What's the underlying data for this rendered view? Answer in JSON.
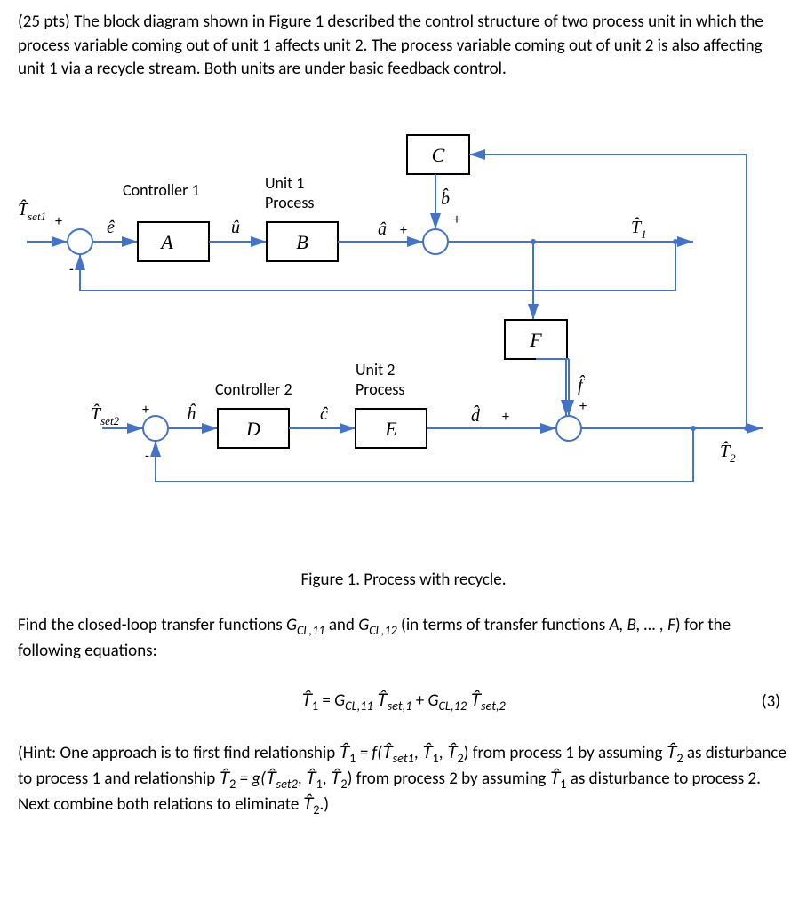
{
  "problem": {
    "points": "(25 pts)",
    "intro": "The block diagram shown in Figure 1 described the control structure of two process unit in which the process variable coming out of unit 1 affects unit 2.  The process variable coming out of unit 2 is also affecting unit 1 via a recycle stream.  Both units are under basic feedback control."
  },
  "diagram": {
    "labels": {
      "controller1": "Controller 1",
      "unit1_process_l1": "Unit 1",
      "unit1_process_l2": "Process",
      "controller2": "Controller 2",
      "unit2_process_l1": "Unit 2",
      "unit2_process_l2": "Process"
    },
    "blocks": {
      "A": "A",
      "B": "B",
      "C": "C",
      "D": "D",
      "E": "E",
      "F": "F"
    },
    "signals": {
      "Tset1": "T̂",
      "Tset1_sub": "set1",
      "Tset2": "T̂",
      "Tset2_sub": "set2",
      "e_hat": "ê",
      "u_hat": "û",
      "a_hat": "â",
      "b_hat": "b̂",
      "h_hat": "ĥ",
      "c_hat": "ĉ",
      "d_hat": "d̂",
      "f_hat": "f̂",
      "T1_hat": "T̂",
      "T1_sub": "1",
      "T2_hat": "T̂",
      "T2_sub": "2",
      "plus": "+",
      "minus": "-"
    }
  },
  "figure_caption": "Figure 1.  Process with recycle.",
  "find": {
    "prefix": "Find the closed-loop transfer functions ",
    "g11": "G",
    "g11_sub": "CL,11",
    "and": " and ",
    "g12": "G",
    "g12_sub": "CL,12",
    "suffix1": " (in terms of transfer functions ",
    "tf_list": "A, B, … , F",
    "suffix2": ") for the following equations:"
  },
  "equation": {
    "lhs": "T̂",
    "lhs_sub": "1",
    "eq": " = ",
    "g11": "G",
    "g11_sub": "CL,11",
    "sp": " ",
    "Tset1": "T̂",
    "Tset1_sub": "set,1",
    "plus": " +  ",
    "g12": "G",
    "g12_sub": "CL,12",
    "Tset2": "T̂",
    "Tset2_sub": "set,2",
    "number": "(3)"
  },
  "hint": {
    "prefix": "(Hint:  One approach is to first find relationship ",
    "T1": "T̂",
    "T1_sub": "1",
    "eq1": " = f(",
    "Tset1": "T̂",
    "Tset1_sub": "set1",
    "comma": ", ",
    "T1b": "T̂",
    "T1b_sub": "1",
    "T2": "T̂",
    "T2_sub": "2",
    "close": ")",
    "mid1": " from process 1 by assuming ",
    "T2b": "T̂",
    "T2b_sub": "2",
    "mid2": " as disturbance to process 1 and relationship ",
    "T2c": "T̂",
    "T2c_sub": "2",
    "eq2": " = g(",
    "Tset2": "T̂",
    "Tset2_sub": "set2",
    "T1c": "T̂",
    "T1c_sub": "1",
    "T2d": "T̂",
    "T2d_sub": "2",
    "mid3": " from process 2 by assuming ",
    "T1d": "T̂",
    "T1d_sub": "1",
    "mid4": " as disturbance to process 2.  Next combine both relations to eliminate ",
    "T2e": "T̂",
    "T2e_sub": "2",
    "end": ".)"
  }
}
